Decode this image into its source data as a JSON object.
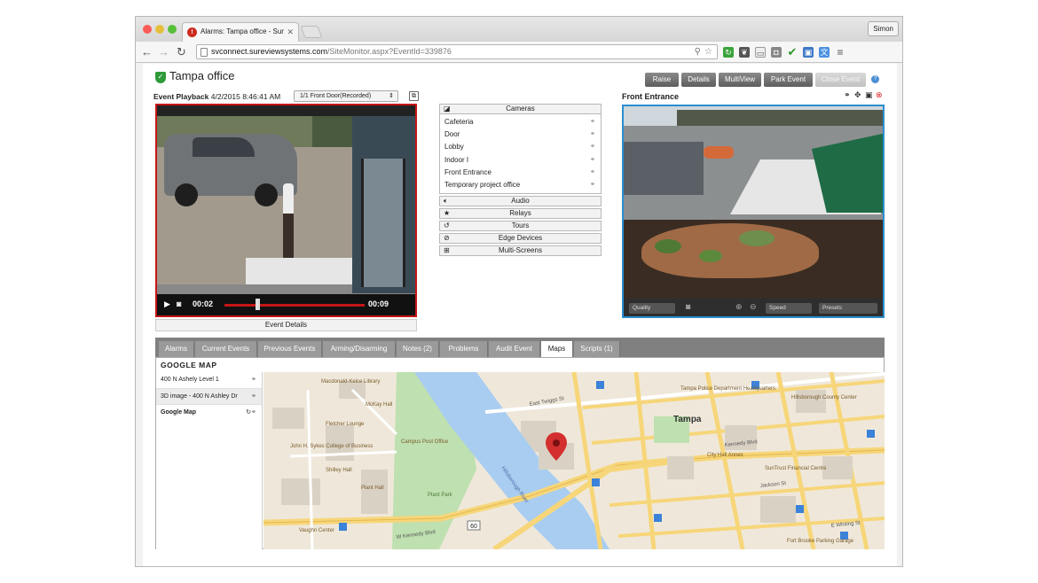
{
  "browser": {
    "tab_title": "Alarms: Tampa office - Sur",
    "url_host": "svconnect.sureviewsystems.com",
    "url_path": "/SiteMonitor.aspx?EventId=339876",
    "user": "Simon"
  },
  "site": {
    "name": "Tampa office",
    "buttons": [
      "Raise",
      "Details",
      "MultiView",
      "Park Event",
      "Close Event"
    ]
  },
  "playback": {
    "label": "Event Playback",
    "datetime": "4/2/2015 8:46:41 AM",
    "camera_select": "1/1 Front Door(Recorded)",
    "time_current": "00:02",
    "time_total": "00:09",
    "progress": 0.22,
    "event_details": "Event Details"
  },
  "cameras_panel": {
    "header": "Cameras",
    "items": [
      "Cafeteria",
      "Door",
      "Lobby",
      "Indoor I",
      "Front Entrance",
      "Temporary project office"
    ],
    "sections": [
      "Audio",
      "Relays",
      "Tours",
      "Edge Devices",
      "Multi-Screens"
    ]
  },
  "live": {
    "title": "Front Entrance",
    "quality": "Quality",
    "speed": "Speed",
    "presets": "Presets"
  },
  "tabs": {
    "items": [
      "Alarms",
      "Current Events",
      "Previous Events",
      "Arming/Disarming",
      "Notes (2)",
      "Problems",
      "Audit Event",
      "Maps",
      "Scripts (1)"
    ],
    "active": "Maps"
  },
  "map": {
    "title": "GOOGLE MAP",
    "list": [
      "400 N Ashely Level 1",
      "3D image - 400 N Ashley Dr",
      "Google Map"
    ],
    "labels": {
      "city": "Tampa",
      "river": "Hillsborough River",
      "twiggs": "East Twiggs St",
      "kennedy": "Kennedy Blvd",
      "kennedy2": "W Kennedy Blvd",
      "jackson": "Jackson St",
      "whiting": "E Whiting St",
      "garage": "Fort Brooke Parking Garage",
      "cityhall": "City Hall Annex",
      "police": "Tampa Police Department Headquarters",
      "convention": "Hillsborough County Center",
      "sykes": "John H. Sykes College of Business",
      "shilley": "Shilley Hall",
      "plant": "Plant Hall",
      "mckay": "McKay Hall",
      "fletcher": "Fletcher Lounge",
      "vaughn": "Vaughn Center",
      "campus": "Campus Post Office",
      "macdonald": "Macdonald-Kelce Library",
      "suntrust": "SunTrust Financial Centre",
      "fl60": "60",
      "plantpark": "Plant Park"
    }
  },
  "colors": {
    "alarm_red": "#c51616",
    "live_border": "#2a8ed0",
    "site_ok": "#2e9a3a",
    "map_water": "#a9cdf0",
    "map_park": "#bfe0b0",
    "map_road": "#f7d67a"
  }
}
